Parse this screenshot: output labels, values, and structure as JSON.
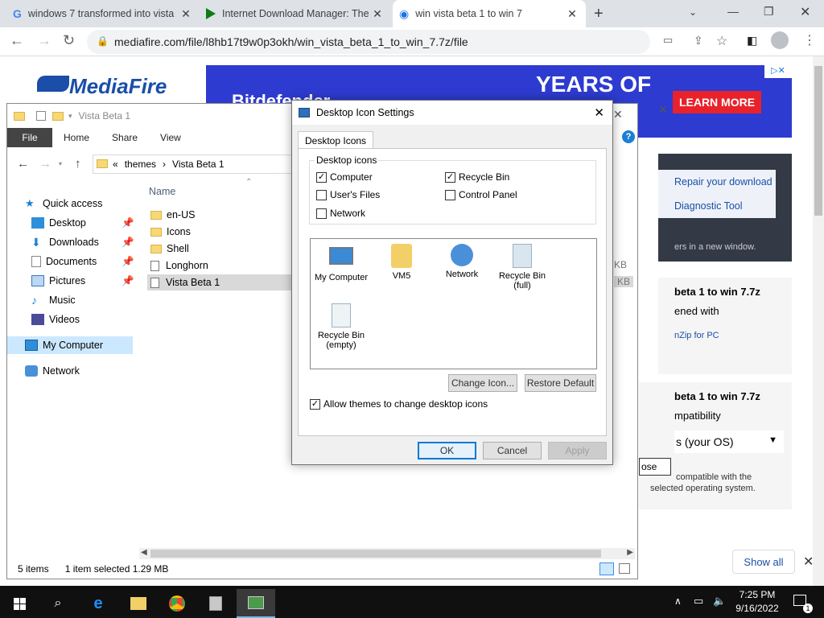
{
  "browser": {
    "tabs": [
      {
        "title": "windows 7 transformed into vista"
      },
      {
        "title": "Internet Download Manager: The"
      },
      {
        "title": "win vista beta 1 to win 7"
      }
    ],
    "url": "mediafire.com/file/l8hb17t9w0p3okh/win_vista_beta_1_to_win_7.7z/file"
  },
  "mediafire": {
    "logo": "MediaFire",
    "ad_years": "YEARS OF",
    "ad_learn": "LEARN MORE",
    "ad_partial": "Bitdefender",
    "repair": "Repair your download",
    "diag": "Diagnostic Tool",
    "new_window": "ers in a new window.",
    "file1_title": "beta 1 to win 7.7z",
    "opened_with": "ened with",
    "zip_link": "nZip for PC",
    "file2_title": "beta 1 to win 7.7z",
    "compat": "mpatibility",
    "os_select": "s (your OS)",
    "close": "ose",
    "compat_note1": "compatible with the",
    "compat_note2": "selected operating system.",
    "show_all": "Show all"
  },
  "explorer": {
    "title": "Vista Beta 1",
    "ribbon": [
      "File",
      "Home",
      "Share",
      "View"
    ],
    "breadcrumb": [
      "themes",
      "Vista Beta 1"
    ],
    "column_name": "Name",
    "nav": [
      {
        "label": "Quick access"
      },
      {
        "label": "Desktop"
      },
      {
        "label": "Downloads"
      },
      {
        "label": "Documents"
      },
      {
        "label": "Pictures"
      },
      {
        "label": "Music"
      },
      {
        "label": "Videos"
      },
      {
        "label": "My Computer"
      },
      {
        "label": "Network"
      }
    ],
    "files": [
      {
        "name": "en-US"
      },
      {
        "name": "Icons"
      },
      {
        "name": "Shell"
      },
      {
        "name": "Longhorn"
      },
      {
        "name": "Vista Beta 1"
      }
    ],
    "size_frag": "KB",
    "status_items": "5 items",
    "status_selected": "1 item selected  1.29 MB"
  },
  "dialog": {
    "title": "Desktop Icon Settings",
    "tab": "Desktop Icons",
    "group_label": "Desktop icons",
    "checkboxes": [
      {
        "label": "Computer",
        "checked": "✓"
      },
      {
        "label": "Recycle Bin",
        "checked": "✓"
      },
      {
        "label": "User's Files",
        "checked": ""
      },
      {
        "label": "Control Panel",
        "checked": ""
      },
      {
        "label": "Network",
        "checked": ""
      }
    ],
    "icons": [
      {
        "label": "My Computer"
      },
      {
        "label": "VM5"
      },
      {
        "label": "Network"
      },
      {
        "label": "Recycle Bin (full)"
      },
      {
        "label": "Recycle Bin (empty)"
      }
    ],
    "change_icon": "Change Icon...",
    "restore_default": "Restore Default",
    "allow_themes": "Allow themes to change desktop icons",
    "ok": "OK",
    "cancel": "Cancel",
    "apply": "Apply"
  },
  "taskbar": {
    "time": "7:25 PM",
    "date": "9/16/2022",
    "notif_count": "1"
  }
}
